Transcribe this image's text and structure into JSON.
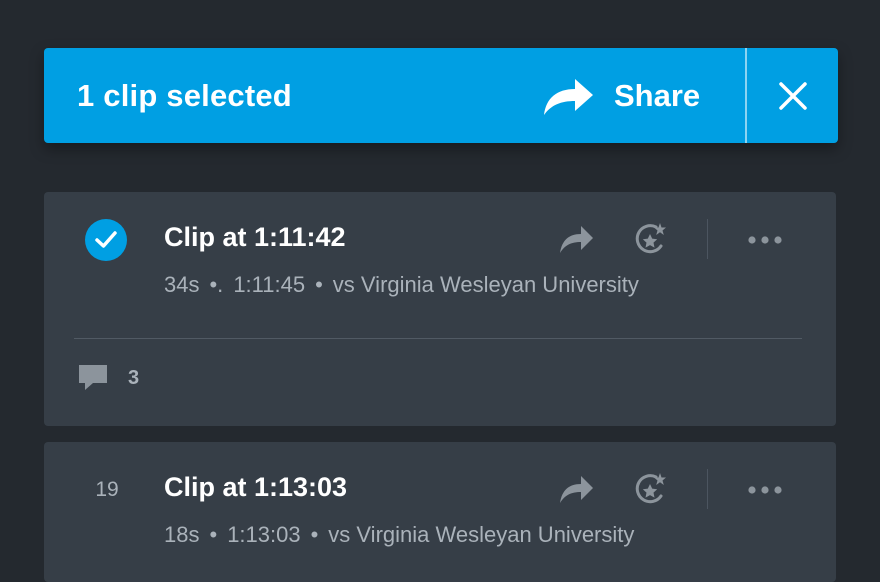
{
  "selection_bar": {
    "count_label": "1 clip selected",
    "share_label": "Share",
    "share_icon": "share-arrow-icon",
    "close_icon": "close-icon",
    "color": "#009fe3"
  },
  "clips": [
    {
      "selected": true,
      "index": "",
      "title": "Clip at 1:11:42",
      "duration": "34s",
      "time_prefix": "•.",
      "timestamp": "1:11:45",
      "separator": "•",
      "opponent": "vs Virginia Wesleyan University",
      "comment_count": "3"
    },
    {
      "selected": false,
      "index": "19",
      "title": "Clip at 1:13:03",
      "duration": "18s",
      "time_prefix": "•",
      "timestamp": "1:13:03",
      "separator": "•",
      "opponent": "vs Virginia Wesleyan University"
    }
  ],
  "colors": {
    "background": "#24292f",
    "card": "#363e47",
    "accent": "#009fe3",
    "muted_text": "#aab2ba",
    "icon": "#8c949c"
  }
}
